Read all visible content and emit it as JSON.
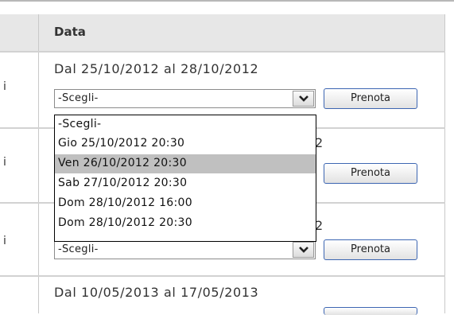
{
  "table": {
    "header": "Data",
    "left_fragment": "i",
    "rows": [
      {
        "date_range": "Dal 25/10/2012 al 28/10/2012",
        "select_value": "-Scegli-",
        "button": "Prenota"
      },
      {
        "date_range_tail": "2",
        "button": "Prenota"
      },
      {
        "date_range_tail": "2",
        "select_value": "-Scegli-",
        "button": "Prenota"
      },
      {
        "date_range": "Dal 10/05/2013 al 17/05/2013"
      }
    ]
  },
  "dropdown": {
    "options": [
      "-Scegli-",
      "Gio 25/10/2012 20:30",
      "Ven 26/10/2012 20:30",
      "Sab 27/10/2012 20:30",
      "Dom 28/10/2012 16:00",
      "Dom 28/10/2012 20:30"
    ],
    "highlighted": "Ven 26/10/2012 20:30"
  },
  "icons": {
    "select_arrow": "chevron-down-icon"
  }
}
